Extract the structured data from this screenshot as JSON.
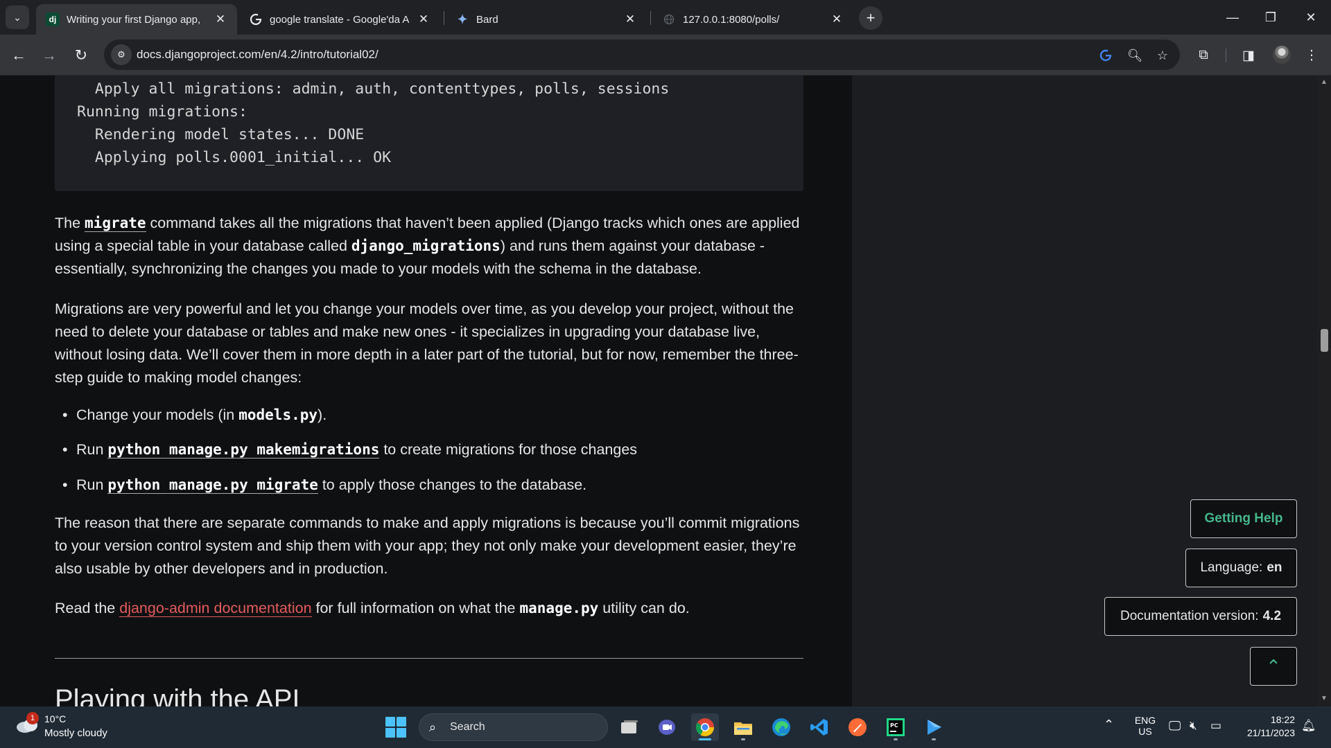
{
  "browser": {
    "tabs": [
      {
        "title": "Writing your first Django app,",
        "favicon": "dj",
        "active": true
      },
      {
        "title": "google translate - Google'da A",
        "favicon": "G",
        "active": false
      },
      {
        "title": "Bard",
        "favicon": "bard-sparkle",
        "active": false
      },
      {
        "title": "127.0.0.1:8080/polls/",
        "favicon": "globe",
        "active": false
      }
    ],
    "url": "docs.djangoproject.com/en/4.2/intro/tutorial02/"
  },
  "code_block": {
    "lines": [
      "  Apply all migrations: admin, auth, contenttypes, polls, sessions",
      "Running migrations:",
      "  Rendering model states... DONE",
      "  Applying polls.0001_initial... OK"
    ]
  },
  "content": {
    "p1": {
      "t1": "The ",
      "c1": "migrate",
      "t2": " command takes all the migrations that haven’t been applied (Django tracks which ones are applied using a special table in your database called ",
      "c2": "django_migrations",
      "t3": ") and runs them against your database - essentially, synchronizing the changes you made to your models with the schema in the database."
    },
    "p2": "Migrations are very powerful and let you change your models over time, as you develop your project, without the need to delete your database or tables and make new ones - it specializes in upgrading your database live, without losing data. We’ll cover them in more depth in a later part of the tutorial, but for now, remember the three-step guide to making model changes:",
    "list": [
      {
        "pre": "Change your models (in ",
        "code": "models.py",
        "post": ")."
      },
      {
        "pre": "Run ",
        "code": "python manage.py makemigrations",
        "post": " to create migrations for those changes"
      },
      {
        "pre": "Run ",
        "code": "python manage.py migrate",
        "post": " to apply those changes to the database."
      }
    ],
    "p3": "The reason that there are separate commands to make and apply migrations is because you’ll commit migrations to your version control system and ship them with your app; they not only make your development easier, they’re also usable by other developers and in production.",
    "p4": {
      "t1": "Read the ",
      "link": "django-admin documentation",
      "t2": " for full information on what the ",
      "code": "manage.py",
      "t3": " utility can do."
    },
    "heading": "Playing with the API"
  },
  "floating": {
    "getting_help": "Getting Help",
    "language_label": "Language:",
    "language_value": "en",
    "docver_label": "Documentation version:",
    "docver_value": "4.2",
    "back_to_top": "⌃"
  },
  "taskbar": {
    "weather_temp": "10°C",
    "weather_desc": "Mostly cloudy",
    "weather_badge": "1",
    "search_placeholder": "Search",
    "lang_top": "ENG",
    "lang_bottom": "US",
    "time": "18:22",
    "date": "21/11/2023"
  },
  "colors": {
    "accent_green": "#44b78b",
    "link_red": "#e35c5c",
    "page_bg": "#0f1012"
  }
}
